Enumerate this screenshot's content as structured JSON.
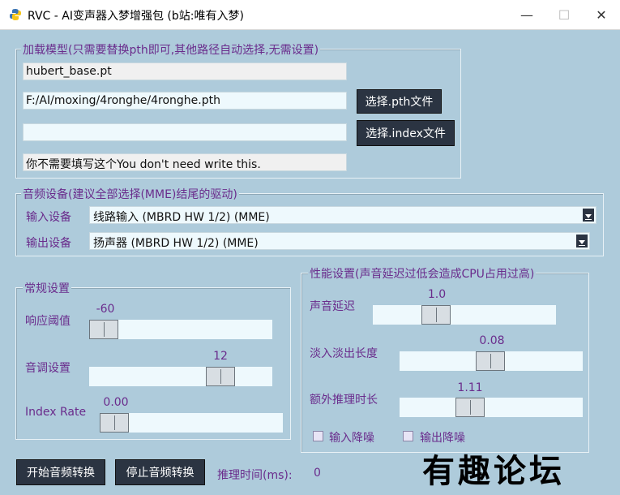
{
  "window": {
    "title": "RVC - AI变声器入梦增强包 (b站:唯有入梦)",
    "minimize_glyph": "—",
    "maximize_glyph": "☐",
    "close_glyph": "✕",
    "icon": "python-icon"
  },
  "model_section": {
    "title": "加载模型(只需要替换pth即可,其他路径自动选择,无需设置)",
    "hubert_path": "hubert_base.pt",
    "pth_path": "F:/AI/moxing/4ronghe/4ronghe.pth",
    "index_path": "",
    "note_field": "你不需要填写这个You don't need write this.",
    "select_pth_label": "选择.pth文件",
    "select_index_label": "选择.index文件"
  },
  "audio_section": {
    "title": "音频设备(建议全部选择(MME)结尾的驱动)",
    "input_label": "输入设备",
    "input_value": "线路输入 (MBRD HW 1/2) (MME)",
    "output_label": "输出设备",
    "output_value": "扬声器 (MBRD HW 1/2) (MME)"
  },
  "general_section": {
    "title": "常规设置",
    "threshold_label": "响应阈值",
    "threshold_value": "-60",
    "pitch_label": "音调设置",
    "pitch_value": "12",
    "index_rate_label": "Index Rate",
    "index_rate_value": "0.00"
  },
  "perf_section": {
    "title": "性能设置(声音延迟过低会造成CPU占用过高)",
    "delay_label": "声音延迟",
    "delay_value": "1.0",
    "fade_label": "淡入淡出长度",
    "fade_value": "0.08",
    "extra_label": "额外推理时长",
    "extra_value": "1.11",
    "input_denoise_label": "输入降噪",
    "output_denoise_label": "输出降噪"
  },
  "footer": {
    "start_label": "开始音频转换",
    "stop_label": "停止音频转换",
    "infer_time_label": "推理时间(ms):",
    "infer_time_value": "0",
    "watermark": "有趣论坛"
  }
}
